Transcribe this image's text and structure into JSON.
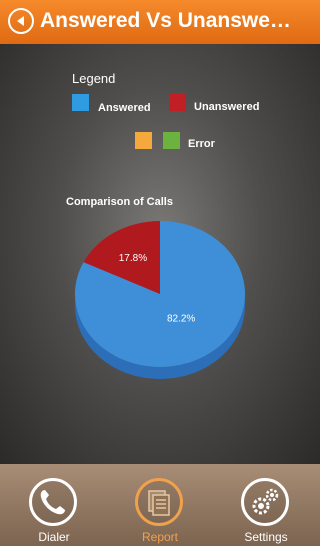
{
  "header": {
    "title": "Answered Vs Unanswe…",
    "back_icon": "back-arrow-icon"
  },
  "legend": {
    "title": "Legend",
    "items": [
      {
        "label": "Answered",
        "color": "#2f9be0"
      },
      {
        "label": "Unanswered",
        "color": "#c01f23"
      },
      {
        "label": "Error",
        "colors": [
          "#f5a83c",
          "#6cb23f"
        ]
      }
    ]
  },
  "chart_data": {
    "type": "pie",
    "title": "Comparison of Calls",
    "slices": [
      {
        "label": "Answered",
        "value": 82.2,
        "display": "82.2%",
        "color": "#3f8fd8",
        "side_color": "#2c6fb8"
      },
      {
        "label": "Unanswered",
        "value": 17.8,
        "display": "17.8%",
        "color": "#b01a1e",
        "side_color": "#8a1215"
      }
    ]
  },
  "footer": {
    "tabs": [
      {
        "label": "Dialer",
        "icon": "phone-icon",
        "active": false
      },
      {
        "label": "Report",
        "icon": "report-icon",
        "active": true
      },
      {
        "label": "Settings",
        "icon": "gears-icon",
        "active": false
      }
    ]
  }
}
